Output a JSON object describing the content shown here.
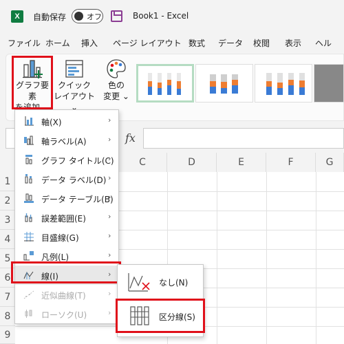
{
  "titlebar": {
    "app_badge": "X",
    "autosave_label": "自動保存",
    "autosave_state": "オフ",
    "doc_title": "Book1  -  Excel"
  },
  "menu_tabs": [
    "ファイル",
    "ホーム",
    "挿入",
    "ページ レイアウト",
    "数式",
    "データ",
    "校閲",
    "表示",
    "ヘル"
  ],
  "ribbon": {
    "add_chart_element": {
      "line1": "グラフ要素",
      "line2": "を追加 ⌄"
    },
    "quick_layout": {
      "line1": "クイック",
      "line2": "レイアウト ⌄"
    },
    "change_colors": {
      "line1": "色の",
      "line2": "変更 ⌄"
    }
  },
  "formula_bar": {
    "fx": "fx"
  },
  "columns": [
    "C",
    "D",
    "E",
    "F",
    "G"
  ],
  "rows": [
    "1",
    "2",
    "3",
    "4",
    "5",
    "6",
    "7",
    "8",
    "9"
  ],
  "dropdown": {
    "items": [
      {
        "label": "軸(X)",
        "icon": "axes-icon",
        "enabled": true
      },
      {
        "label": "軸ラベル(A)",
        "icon": "axis-title-icon",
        "enabled": true
      },
      {
        "label": "グラフ タイトル(C)",
        "icon": "chart-title-icon",
        "enabled": true
      },
      {
        "label": "データ ラベル(D)",
        "icon": "data-labels-icon",
        "enabled": true
      },
      {
        "label": "データ テーブル(B)",
        "icon": "data-table-icon",
        "enabled": true
      },
      {
        "label": "誤差範囲(E)",
        "icon": "error-bars-icon",
        "enabled": true
      },
      {
        "label": "目盛線(G)",
        "icon": "gridlines-icon",
        "enabled": true
      },
      {
        "label": "凡例(L)",
        "icon": "legend-icon",
        "enabled": true
      },
      {
        "label": "線(I)",
        "icon": "lines-icon",
        "enabled": true
      },
      {
        "label": "近似曲線(T)",
        "icon": "trendline-icon",
        "enabled": false
      },
      {
        "label": "ローソク(U)",
        "icon": "up-down-bars-icon",
        "enabled": false
      }
    ]
  },
  "submenu": {
    "items": [
      {
        "label": "なし(N)",
        "icon": "no-lines-icon"
      },
      {
        "label": "区分線(S)",
        "icon": "series-lines-icon"
      }
    ]
  },
  "colors": {
    "highlight_red": "#e0101a",
    "excel_green": "#107c41",
    "accent_blue": "#3a7bd5",
    "accent_orange": "#ee7d31"
  }
}
